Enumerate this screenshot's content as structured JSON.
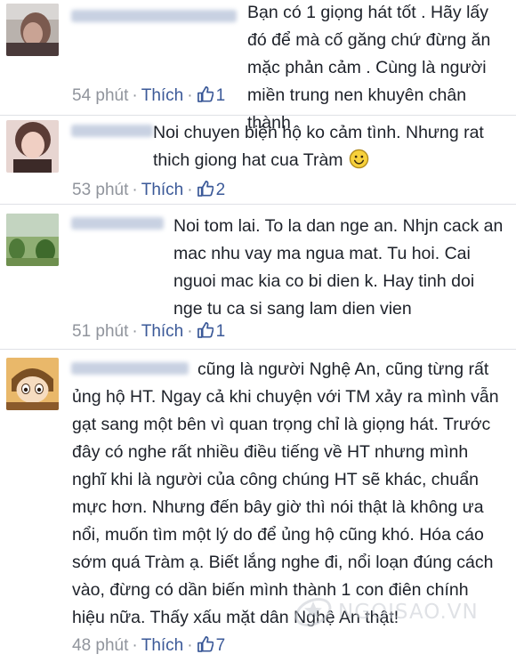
{
  "comments": [
    {
      "text": "Bạn có 1 giọng hát tốt . Hãy lấy đó để mà cố găng chứ đừng ăn mặc phản cảm . Cùng là người miền trung nen khuyên chân thành",
      "time": "54 phút",
      "like_label": "Thích",
      "likes": "1",
      "has_smiley": false
    },
    {
      "text": "Noi chuyen biện hộ ko cảm tình. Nhưng rat thich giong hat cua Tràm",
      "time": "53 phút",
      "like_label": "Thích",
      "likes": "2",
      "has_smiley": true
    },
    {
      "text": "Noi tom lai. To la dan nge an. Nhjn cack an mac nhu vay ma ngua mat. Tu hoi. Cai nguoi mac kia co bi dien k. Hay tinh doi nge tu ca si sang lam dien vien",
      "time": "51 phút",
      "like_label": "Thích",
      "likes": "1",
      "has_smiley": false
    },
    {
      "text": "cũng là người Nghệ An, cũng từng rất ủng hộ HT. Ngay cả khi chuyện với TM xảy ra mình vẫn gạt sang một bên vì quan trọng chỉ là giọng hát. Trước đây có nghe rất nhiều điều tiếng về HT nhưng mình nghĩ khi là người của công chúng HT sẽ khác, chuẩn mực hơn. Nhưng đến bây giờ thì nói thật là không ưa nổi, muốn tìm một lý do để ủng hộ cũng khó. Hóa cáo sớm quá Tràm ạ. Biết lắng nghe đi, nổi loạn đúng cách vào, đừng có dần biến mình thành 1 con điên chính hiệu nữa. Thấy xấu mặt dân Nghệ An thật!",
      "time": "48 phút",
      "like_label": "Thích",
      "likes": "7",
      "has_smiley": false
    }
  ],
  "watermark": "NGOISAO.VN",
  "colors": {
    "link": "#3b5998",
    "meta": "#90949c",
    "text": "#1d2129",
    "divider": "#dfe1e6"
  },
  "icons": {
    "like": "thumbs-up-icon",
    "emoji": "smiley-icon",
    "watermark": "ngoisao-logo"
  }
}
